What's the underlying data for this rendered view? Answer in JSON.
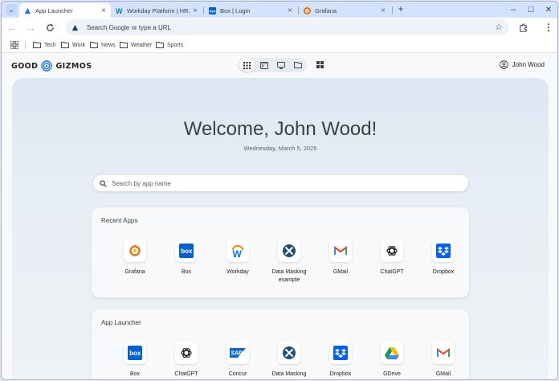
{
  "browser": {
    "tabs": [
      {
        "label": "App Launcher",
        "icon": "good-gizmos-favicon",
        "active": true
      },
      {
        "label": "Workday Platform | HR, Fina",
        "icon": "workday-favicon",
        "active": false
      },
      {
        "label": "Box | Login",
        "icon": "box-favicon",
        "active": false
      },
      {
        "label": "Grafana",
        "icon": "grafana-favicon",
        "active": false
      }
    ],
    "new_tab_symbol": "+",
    "window_controls": {
      "minimize": "–",
      "maximize": "☐",
      "close": "✕"
    },
    "address_bar": {
      "placeholder": "Search Google or type a URL",
      "value": ""
    },
    "bookmarks": [
      "Tech",
      "Work",
      "News",
      "Weather",
      "Sports"
    ]
  },
  "header": {
    "brand_left": "GOOD",
    "brand_right": "GIZMOS",
    "view_icons": [
      "grid-icon",
      "terminal-icon",
      "desktop-icon",
      "folder-icon"
    ],
    "user_name": "John Wood"
  },
  "main": {
    "welcome": "Welcome, John Wood!",
    "date": "Wednesday, March 5, 2025",
    "search_placeholder": "Search by app name",
    "recent": {
      "title": "Recent Apps",
      "apps": [
        {
          "label": "Grafana",
          "icon": "grafana-icon"
        },
        {
          "label": "Box",
          "icon": "box-icon"
        },
        {
          "label": "Workday",
          "icon": "workday-icon"
        },
        {
          "label": "Data Masking example",
          "icon": "data-masking-icon"
        },
        {
          "label": "GMail",
          "icon": "gmail-icon"
        },
        {
          "label": "ChatGPT",
          "icon": "chatgpt-icon"
        },
        {
          "label": "Dropbox",
          "icon": "dropbox-icon"
        }
      ]
    },
    "launcher": {
      "title": "App Launcher",
      "apps": [
        {
          "label": "Box",
          "icon": "box-icon"
        },
        {
          "label": "ChatGPT",
          "icon": "chatgpt-icon"
        },
        {
          "label": "Concur",
          "icon": "sap-concur-icon"
        },
        {
          "label": "Data Masking",
          "icon": "data-masking-icon"
        },
        {
          "label": "Dropbox",
          "icon": "dropbox-icon"
        },
        {
          "label": "GDrive",
          "icon": "gdrive-icon"
        },
        {
          "label": "GMail",
          "icon": "gmail-icon"
        }
      ]
    }
  },
  "colors": {
    "accent_blue": "#1a73e8",
    "box_blue": "#0061d5",
    "dropbox_blue": "#0061fe",
    "tabstrip": "#d3e3fd",
    "grafana_orange": "#f46800",
    "workday_orange": "#f38b00",
    "gmail_red": "#ea4335"
  }
}
